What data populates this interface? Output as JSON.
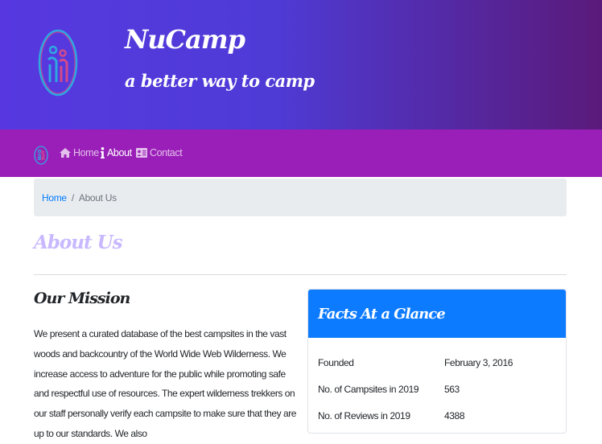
{
  "header": {
    "brand_title": "NuCamp",
    "brand_subtitle": "a better way to camp"
  },
  "nav": {
    "items": [
      {
        "label": "Home",
        "icon": "home-icon"
      },
      {
        "label": "About",
        "icon": "info-icon",
        "active": true
      },
      {
        "label": "Contact",
        "icon": "address-card-icon"
      }
    ]
  },
  "breadcrumb": {
    "home": "Home",
    "separator": "/",
    "current": "About Us"
  },
  "page": {
    "title": "About Us"
  },
  "mission": {
    "title": "Our Mission",
    "text": "We present a curated database of the best campsites in the vast woods and backcountry of the World Wide Web Wilderness. We increase access to adventure for the public while promoting safe and respectful use of resources. The expert wilderness trekkers on our staff personally verify each campsite to make sure that they are up to our standards. We also"
  },
  "facts": {
    "title": "Facts At a Glance",
    "rows": [
      {
        "label": "Founded",
        "value": "February 3, 2016"
      },
      {
        "label": "No. of Campsites in 2019",
        "value": "563"
      },
      {
        "label": "No. of Reviews in 2019",
        "value": "4388"
      }
    ]
  },
  "colors": {
    "jumbotron_start": "#5738e0",
    "jumbotron_end": "#5a1a7a",
    "navbar": "#9a1fb8",
    "link": "#007bff",
    "card_header": "#0d7bff",
    "page_title": "#c8b8ff"
  }
}
